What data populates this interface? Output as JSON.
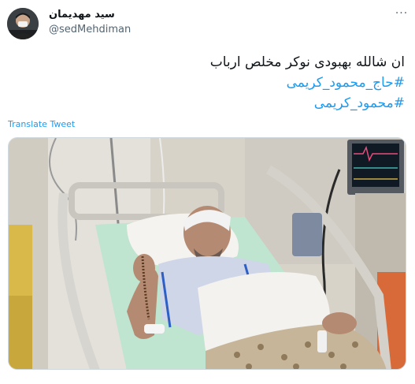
{
  "author": {
    "display_name": "سید مهدیمان",
    "handle": "@sedMehdiman",
    "avatar_icon": "avatar-photo"
  },
  "menu": {
    "more_label": "···",
    "icon": "more-options-icon"
  },
  "tweet": {
    "line1": "ان شالله بهبودی نوکر مخلص ارباب",
    "hashtag1": "#حاج_محمود_کریمی",
    "hashtag2": "#محمود_کریمی"
  },
  "translate_label": "Translate Tweet",
  "media": {
    "icon": "hospital-photo"
  },
  "colors": {
    "link": "#1d9bf0",
    "secondary_text": "#536471",
    "border": "#cfd9de"
  }
}
